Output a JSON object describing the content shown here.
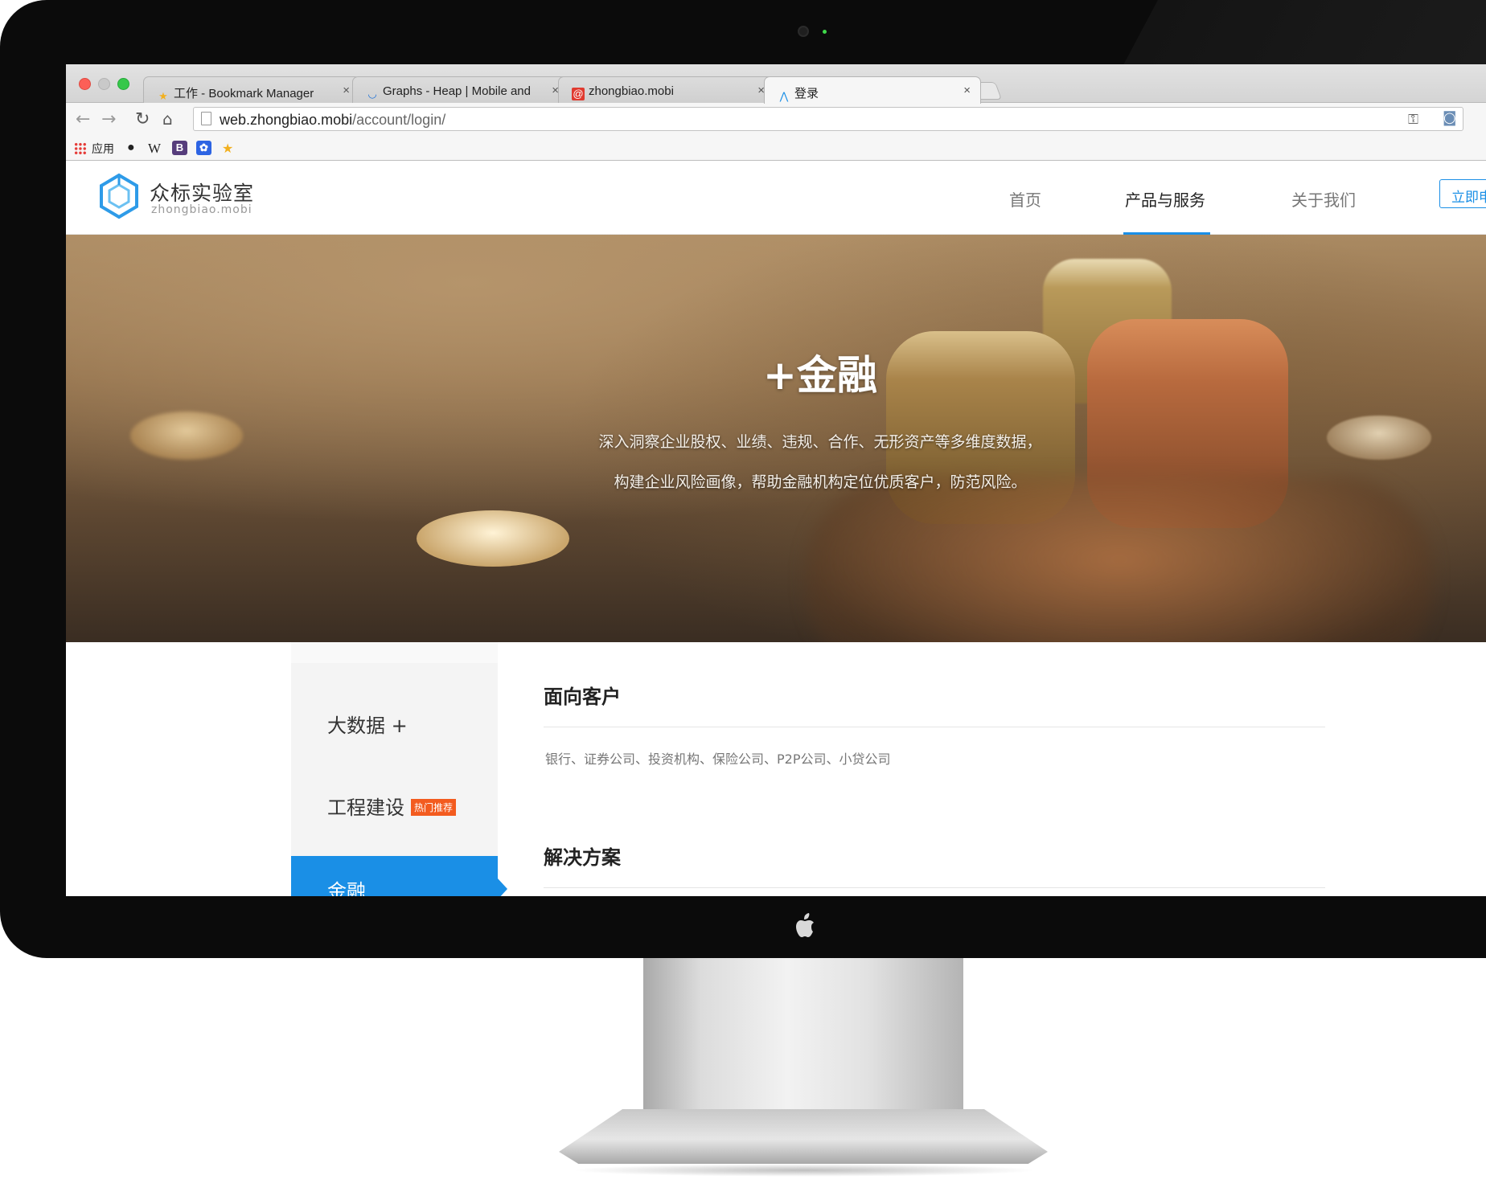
{
  "browser": {
    "tabs": [
      {
        "icon": "star-bookmark-icon",
        "title": "工作 - Bookmark Manager",
        "close": "×"
      },
      {
        "icon": "heap-icon",
        "title": "Graphs - Heap | Mobile and",
        "close": "×"
      },
      {
        "icon": "at-mail-icon",
        "title": "zhongbiao.mobi",
        "close": "×"
      },
      {
        "icon": "zhongbiao-logo-icon",
        "title": "登录",
        "close": "×"
      }
    ],
    "active_tab": 3,
    "url": {
      "host": "web.zhongbiao.mobi",
      "path": "/account/login/"
    },
    "bookmarks": {
      "apps_label": "应用",
      "items": [
        "apple-icon",
        "wikipedia-icon",
        "bootstrap-icon",
        "baidu-icon",
        "star-icon"
      ],
      "wiki_glyph": "W",
      "bootstrap_glyph": "B"
    }
  },
  "site": {
    "logo": {
      "title": "众标实验室",
      "subtitle": "zhongbiao.mobi"
    },
    "nav": [
      {
        "label": "首页",
        "active": false
      },
      {
        "label": "产品与服务",
        "active": true
      },
      {
        "label": "关于我们",
        "active": false
      }
    ],
    "cta_label": "立即申",
    "accent_color": "#1a8fe6"
  },
  "hero": {
    "title": "+金融",
    "line1": "深入洞察企业股权、业绩、违规、合作、无形资产等多维度数据，",
    "line2": "构建企业风险画像，帮助金融机构定位优质客户，防范风险。"
  },
  "sidebar": {
    "items": [
      {
        "label": "大数据 +",
        "badge": "",
        "active": false
      },
      {
        "label": "工程建设",
        "badge": "热门推荐",
        "active": false
      },
      {
        "label": "金融",
        "badge": "",
        "active": true
      }
    ]
  },
  "content": {
    "customers_title": "面向客户",
    "customers_text": "银行、证券公司、投资机构、保险公司、P2P公司、小贷公司",
    "solutions_title": "解决方案"
  }
}
